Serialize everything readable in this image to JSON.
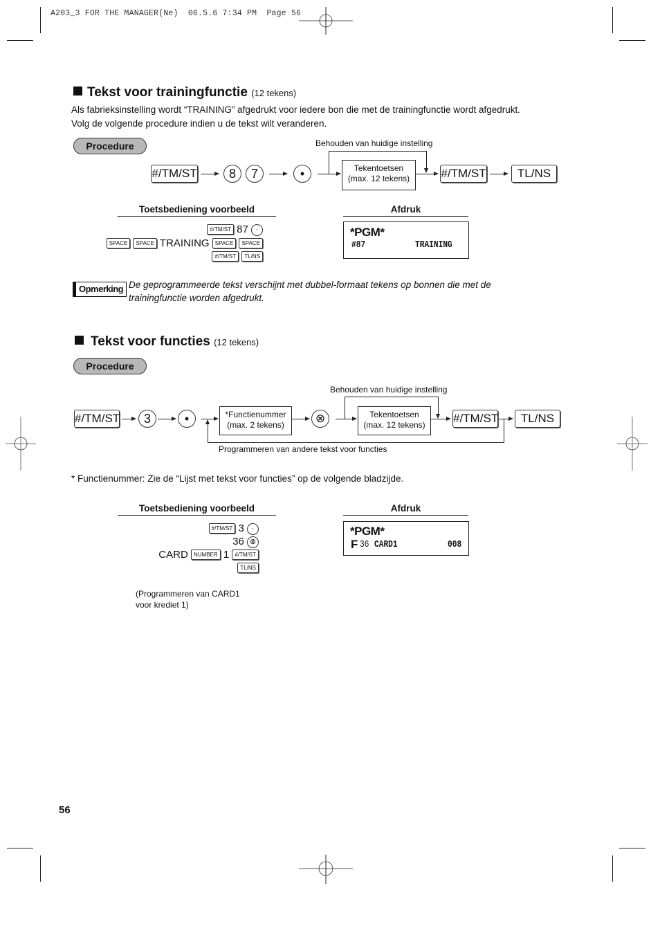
{
  "slug": {
    "text": "A203_3 FOR THE MANAGER(Ne)  06.5.6 7:34 PM  Page 56"
  },
  "section1": {
    "title": "Tekst voor trainingfunctie",
    "title_suffix": "(12 tekens)",
    "intro_line1": "Als fabrieksinstelling wordt “TRAINING” afgedrukt voor iedere bon die met de trainingfunctie wordt afgedrukt.",
    "intro_line2": "Volg de volgende procedure indien u de tekst wilt veranderen.",
    "procedure_label": "Procedure",
    "flow": {
      "key_tmst_1": "#/TM/ST",
      "digit_8": "8",
      "digit_7": "7",
      "point": "•",
      "text_box_line1": "Tekentoetsen",
      "text_box_line2": "(max. 12 tekens)",
      "bypass_label": "Behouden van huidige instelling",
      "key_tmst_2": "#/TM/ST",
      "key_tlns": "TL/NS"
    },
    "example_heading": "Toetsbediening voorbeeld",
    "example": {
      "k_tmst": "#/TM/ST",
      "num": "87",
      "point": "·",
      "k_space": "SPACE",
      "word": "TRAINING",
      "k_tmst2": "#/TM/ST",
      "k_tlns": "TL/NS"
    },
    "print_heading": "Afdruk",
    "print": {
      "line1": "*PGM*",
      "code": "#87",
      "text": "TRAINING"
    },
    "note_label": "Opmerking",
    "note_line1": "De geprogrammeerde tekst verschijnt met dubbel-formaat tekens op bonnen die met de",
    "note_line2": "trainingfunctie worden afgedrukt."
  },
  "section2": {
    "title": "Tekst voor functies",
    "title_suffix": "(12 tekens)",
    "procedure_label": "Procedure",
    "flow": {
      "key_tmst_1": "#/TM/ST",
      "digit_3": "3",
      "point": "•",
      "func_box_line1": "*Functienummer",
      "func_box_line2": "(max. 2 tekens)",
      "multiply": "⊗",
      "text_box_line1": "Tekentoetsen",
      "text_box_line2": "(max. 12 tekens)",
      "bypass_label": "Behouden van huidige instelling",
      "key_tmst_2": "#/TM/ST",
      "key_tlns": "TL/NS",
      "loop_label": "Programmeren van andere tekst voor functies"
    },
    "footnote": "* Functienummer: Zie de “Lijst met tekst voor functies” op de volgende bladzijde.",
    "example_heading": "Toetsbediening voorbeeld",
    "example": {
      "k_tmst": "#/TM/ST",
      "num1": "3",
      "point": "·",
      "num2": "36",
      "multiply": "⊗",
      "word": "CARD",
      "k_number": "NUMBER",
      "num3": "1",
      "k_tmst2": "#/TM/ST",
      "k_tlns": "TL/NS",
      "caption_line1": "(Programmeren van CARD1",
      "caption_line2": "voor krediet 1)"
    },
    "print_heading": "Afdruk",
    "print": {
      "line1": "*PGM*",
      "f": "F",
      "code": "36",
      "text": "CARD1",
      "value": "008"
    }
  },
  "page_number": "56"
}
